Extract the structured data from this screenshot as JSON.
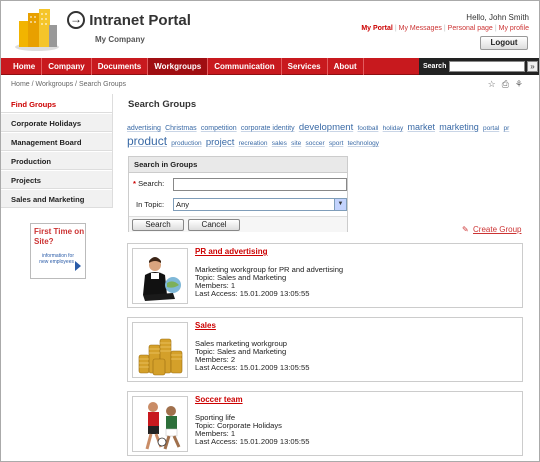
{
  "header": {
    "title": "Intranet Portal",
    "company": "My Company",
    "greeting": "Hello, John Smith",
    "links": [
      "My Portal",
      "My Messages",
      "Personal page",
      "My profile"
    ],
    "logout_label": "Logout"
  },
  "nav": {
    "items": [
      "Home",
      "Company",
      "Documents",
      "Workgroups",
      "Communication",
      "Services",
      "About"
    ],
    "active": "Workgroups",
    "search_label": "Search",
    "go_label": "»"
  },
  "breadcrumb": "Home / Workgroups / Search Groups",
  "sidebar": {
    "items": [
      "Find Groups",
      "Corporate Holidays",
      "Management Board",
      "Production",
      "Projects",
      "Sales and Marketing"
    ]
  },
  "promo": {
    "title": "First Time on Site?",
    "subtitle": "information for new employees"
  },
  "main": {
    "title": "Search Groups",
    "tags": [
      {
        "t": "advertising",
        "s": 7
      },
      {
        "t": "Christmas",
        "s": 7
      },
      {
        "t": "competition",
        "s": 7
      },
      {
        "t": "corporate identity",
        "s": 7
      },
      {
        "t": "development",
        "s": 9.5
      },
      {
        "t": "football",
        "s": 6.5
      },
      {
        "t": "holiday",
        "s": 6.5
      },
      {
        "t": "market",
        "s": 9
      },
      {
        "t": "marketing",
        "s": 9
      },
      {
        "t": "portal",
        "s": 6.5
      },
      {
        "t": "pr",
        "s": 6.5
      },
      {
        "t": "product",
        "s": 12
      },
      {
        "t": "production",
        "s": 6.5
      },
      {
        "t": "project",
        "s": 9.5
      },
      {
        "t": "recreation",
        "s": 6.5
      },
      {
        "t": "sales",
        "s": 6.5
      },
      {
        "t": "site",
        "s": 6.5
      },
      {
        "t": "soccer",
        "s": 6.5
      },
      {
        "t": "sport",
        "s": 6.5
      },
      {
        "t": "technology",
        "s": 6.5
      }
    ],
    "form": {
      "heading": "Search in Groups",
      "search_label": "Search:",
      "search_value": "",
      "topic_label": "In Topic:",
      "topic_value": "Any",
      "search_button": "Search",
      "cancel_button": "Cancel"
    },
    "create_label": "Create Group",
    "groups": [
      {
        "name": "PR and advertising",
        "desc": "Marketing workgroup for PR and advertising",
        "topic": "Topic: Sales and Marketing",
        "members": "Members: 1",
        "access": "Last Access: 15.01.2009 13:05:55"
      },
      {
        "name": "Sales",
        "desc": "Sales marketing workgroup",
        "topic": "Topic: Sales and Marketing",
        "members": "Members: 2",
        "access": "Last Access: 15.01.2009 13:05:55"
      },
      {
        "name": "Soccer team",
        "desc": "Sporting life",
        "topic": "Topic: Corporate Holidays",
        "members": "Members: 1",
        "access": "Last Access: 15.01.2009 13:05:55"
      }
    ]
  },
  "colors": {
    "brand": "#c8191e",
    "link": "#3a6aa6",
    "accent": "#c00000"
  }
}
